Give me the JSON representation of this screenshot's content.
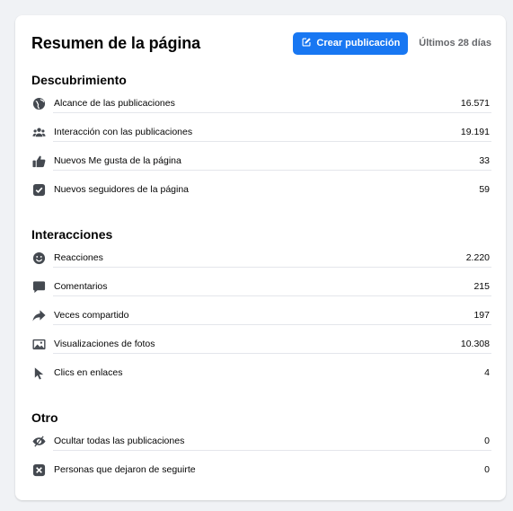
{
  "header": {
    "title": "Resumen de la página",
    "create_label": "Crear publicación",
    "range_label": "Últimos 28 días"
  },
  "sections": [
    {
      "title": "Descubrimiento",
      "rows": [
        {
          "label": "Alcance de las publicaciones",
          "value": "16.571",
          "icon": "globe-icon"
        },
        {
          "label": "Interacción con las publicaciones",
          "value": "19.191",
          "icon": "people-icon"
        },
        {
          "label": "Nuevos Me gusta de la página",
          "value": "33",
          "icon": "thumbs-up-icon"
        },
        {
          "label": "Nuevos seguidores de la página",
          "value": "59",
          "icon": "check-square-icon"
        }
      ]
    },
    {
      "title": "Interacciones",
      "rows": [
        {
          "label": "Reacciones",
          "value": "2.220",
          "icon": "smiley-icon"
        },
        {
          "label": "Comentarios",
          "value": "215",
          "icon": "comment-icon"
        },
        {
          "label": "Veces compartido",
          "value": "197",
          "icon": "share-icon"
        },
        {
          "label": "Visualizaciones de fotos",
          "value": "10.308",
          "icon": "photo-icon"
        },
        {
          "label": "Clics en enlaces",
          "value": "4",
          "icon": "cursor-icon"
        }
      ]
    },
    {
      "title": "Otro",
      "rows": [
        {
          "label": "Ocultar todas las publicaciones",
          "value": "0",
          "icon": "eye-slash-icon"
        },
        {
          "label": "Personas que dejaron de seguirte",
          "value": "0",
          "icon": "x-square-icon"
        }
      ]
    }
  ]
}
